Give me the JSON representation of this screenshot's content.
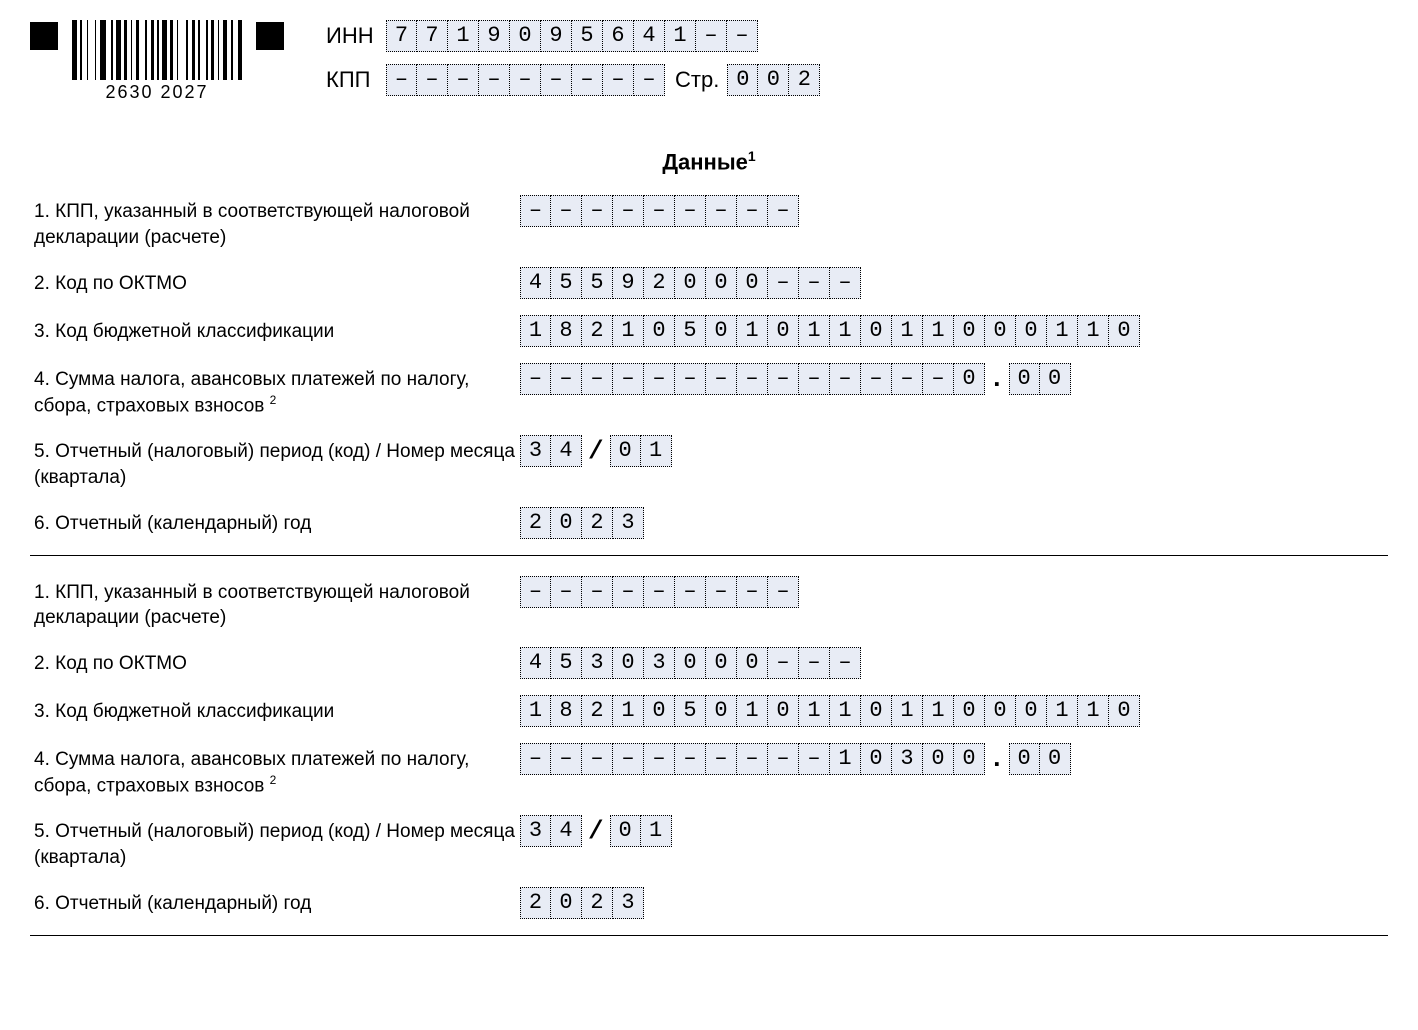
{
  "barcode_text": "2630  2027",
  "header": {
    "inn_label": "ИНН",
    "inn": "7719095641--",
    "kpp_label": "КПП",
    "kpp": "---------",
    "page_label": "Стр.",
    "page": "002"
  },
  "section_title": "Данные",
  "section_title_sup": "1",
  "row_labels": {
    "r1": "1. КПП, указанный в соответствующей налоговой декларации (расчете)",
    "r2": "2. Код по ОКТМО",
    "r3": "3. Код бюджетной классификации",
    "r4_a": "4. Сумма налога, авансовых платежей по налогу, сбора, страховых взносов",
    "r4_sup": "2",
    "r5": "5. Отчетный (налоговый) период (код) / Номер месяца (квартала)",
    "r6": "6. Отчетный (календарный) год"
  },
  "blocks": [
    {
      "kpp": "---------",
      "oktmo": "45592000---",
      "kbk": "18210501011011000110",
      "sum_int": "--------------0",
      "sum_frac": "00",
      "period_a": "34",
      "period_b": "01",
      "year": "2023"
    },
    {
      "kpp": "---------",
      "oktmo": "45303000---",
      "kbk": "18210501011011000110",
      "sum_int": "----------10300",
      "sum_frac": "00",
      "period_a": "34",
      "period_b": "01",
      "year": "2023"
    }
  ]
}
